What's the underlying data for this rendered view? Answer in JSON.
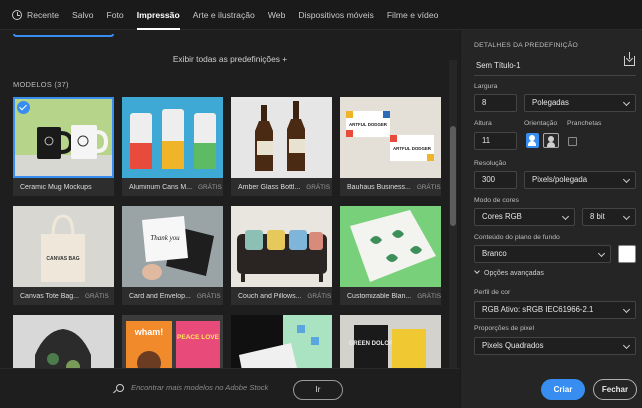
{
  "tabs": [
    {
      "label": "Recente",
      "icon": "clock-icon",
      "active": false
    },
    {
      "label": "Salvo",
      "active": false
    },
    {
      "label": "Foto",
      "active": false
    },
    {
      "label": "Impressão",
      "active": true
    },
    {
      "label": "Arte e ilustração",
      "active": false
    },
    {
      "label": "Web",
      "active": false
    },
    {
      "label": "Dispositivos móveis",
      "active": false
    },
    {
      "label": "Filme e vídeo",
      "active": false
    }
  ],
  "presets_link": "Exibir todas as predefinições +",
  "models_header": "MODELOS  (37)",
  "templates": [
    {
      "name": "Ceramic Mug Mockups",
      "badge": "",
      "selected": true
    },
    {
      "name": "Aluminum Cans M...",
      "badge": "GRÁTIS"
    },
    {
      "name": "Amber Glass Bottl...",
      "badge": "GRÁTIS"
    },
    {
      "name": "Bauhaus Business...",
      "badge": "GRÁTIS"
    },
    {
      "name": "Canvas Tote Bag...",
      "badge": "GRÁTIS"
    },
    {
      "name": "Card and Envelop...",
      "badge": "GRÁTIS"
    },
    {
      "name": "Couch and Pillows...",
      "badge": "GRÁTIS"
    },
    {
      "name": "Customizable Blan...",
      "badge": "GRÁTIS"
    },
    {
      "name": "",
      "badge": ""
    },
    {
      "name": "",
      "badge": ""
    },
    {
      "name": "",
      "badge": ""
    },
    {
      "name": "",
      "badge": ""
    }
  ],
  "thumb_texts": {
    "tote": "CANVAS BAG",
    "card": "Thank you",
    "bauhaus": "ARTFUL DODGER",
    "bauhaus2": "ARTFUL DODGER",
    "poster1": "wham!",
    "poster2": "PEACE LOVE",
    "book": "GREEN DOLOR"
  },
  "search": {
    "placeholder": "Encontrar mais modelos no Adobe Stock",
    "go_label": "Ir"
  },
  "details": {
    "section_title": "DETALHES DA PREDEFINIÇÃO",
    "name": "Sem Título-1",
    "width_label": "Largura",
    "width_value": "8",
    "width_unit": "Polegadas",
    "height_label": "Altura",
    "height_value": "11",
    "orientation_label": "Orientação",
    "artboards_label": "Pranchetas",
    "resolution_label": "Resolução",
    "resolution_value": "300",
    "resolution_unit": "Pixels/polegada",
    "color_mode_label": "Modo de cores",
    "color_mode_value": "Cores RGB",
    "bit_depth": "8 bit",
    "background_label": "Conteúdo do plano de fundo",
    "background_value": "Branco",
    "background_swatch": "#ffffff",
    "advanced_label": "Opções avançadas",
    "profile_label": "Perfil de cor",
    "profile_value": "RGB Ativo: sRGB IEC61966-2.1",
    "pixel_ratio_label": "Proporções de pixel",
    "pixel_ratio_value": "Pixels Quadrados",
    "create_label": "Criar",
    "close_label": "Fechar"
  },
  "colors": {
    "accent": "#378ef0",
    "panel": "#252525",
    "background": "#1e1e1e"
  }
}
